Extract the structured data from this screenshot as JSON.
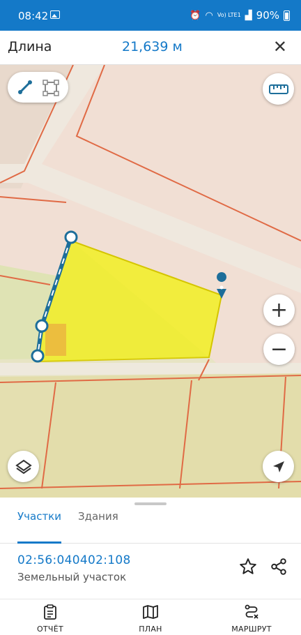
{
  "status_bar": {
    "time": "08:42",
    "signal_label": "Vo) LTE1",
    "battery": "90%"
  },
  "header": {
    "title": "Длина",
    "value": "21,639 м",
    "close_icon": "close-icon"
  },
  "map": {
    "tools": [
      "line-measure-icon",
      "area-measure-icon"
    ],
    "ruler_icon": "ruler-icon",
    "zoom_in_label": "+",
    "zoom_out_label": "−",
    "layers_icon": "layers-icon",
    "location_icon": "navigation-arrow-icon",
    "colors": {
      "parcel_fill": "#f2ee2c",
      "parcel_outline": "#e06a45",
      "measure_line": "#1d6e9a",
      "map_bg": "#f1dfd4",
      "field": "#e3ddab"
    }
  },
  "sheet": {
    "tabs": [
      {
        "label": "Участки",
        "active": true
      },
      {
        "label": "Здания",
        "active": false
      }
    ],
    "parcel_id": "02:56:040402:108",
    "parcel_type": "Земельный участок"
  },
  "bottom_nav": [
    {
      "label": "ОТЧЁТ",
      "icon": "report-icon"
    },
    {
      "label": "ПЛАН",
      "icon": "map-icon"
    },
    {
      "label": "МАРШРУТ",
      "icon": "route-icon"
    }
  ]
}
